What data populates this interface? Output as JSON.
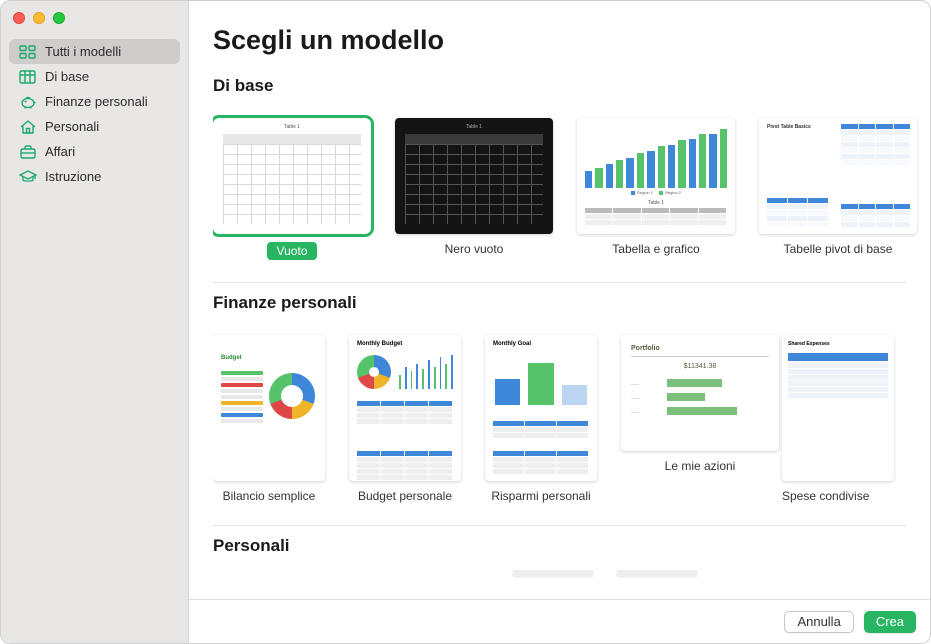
{
  "colors": {
    "accent": "#28b562",
    "icon": "#1aab6a"
  },
  "traffic_lights": [
    "close",
    "minimize",
    "zoom"
  ],
  "sidebar": {
    "items": [
      {
        "icon": "grid-icon",
        "label": "Tutti i modelli",
        "selected": true
      },
      {
        "icon": "table-icon",
        "label": "Di base",
        "selected": false
      },
      {
        "icon": "piggybank-icon",
        "label": "Finanze personali",
        "selected": false
      },
      {
        "icon": "house-icon",
        "label": "Personali",
        "selected": false
      },
      {
        "icon": "briefcase-icon",
        "label": "Affari",
        "selected": false
      },
      {
        "icon": "gradcap-icon",
        "label": "Istruzione",
        "selected": false
      }
    ]
  },
  "main": {
    "title": "Scegli un modello",
    "sections": [
      {
        "heading": "Di base",
        "orientation": "wide",
        "templates": [
          {
            "label": "Vuoto",
            "selected": true,
            "thumb": "blank-light"
          },
          {
            "label": "Nero vuoto",
            "selected": false,
            "thumb": "blank-dark"
          },
          {
            "label": "Tabella e grafico",
            "selected": false,
            "thumb": "chart-table"
          },
          {
            "label": "Tabelle pivot di base",
            "selected": false,
            "thumb": "pivot-basic"
          }
        ]
      },
      {
        "heading": "Finanze personali",
        "orientation": "narrow",
        "templates": [
          {
            "label": "Bilancio semplice",
            "selected": false,
            "thumb": "simple-budget"
          },
          {
            "label": "Budget personale",
            "selected": false,
            "thumb": "monthly-budget"
          },
          {
            "label": "Risparmi personali",
            "selected": false,
            "thumb": "monthly-goal"
          },
          {
            "label": "Le mie azioni",
            "selected": false,
            "thumb": "portfolio"
          },
          {
            "label": "Spese condivise",
            "selected": false,
            "thumb": "shared-expenses",
            "clipped": true
          }
        ]
      },
      {
        "heading": "Personali",
        "orientation": "narrow",
        "templates": []
      }
    ]
  },
  "thumb_text": {
    "table1": "Table 1",
    "pivot_title": "Pivot Table Basics",
    "budget": "Budget",
    "monthly_budget": "Monthly Budget",
    "monthly_goal": "Monthly Goal",
    "portfolio": "Portfolio",
    "portfolio_amount": "$11341.38",
    "shared": "Shared Expenses"
  },
  "footer": {
    "cancel": "Annulla",
    "create": "Crea"
  }
}
